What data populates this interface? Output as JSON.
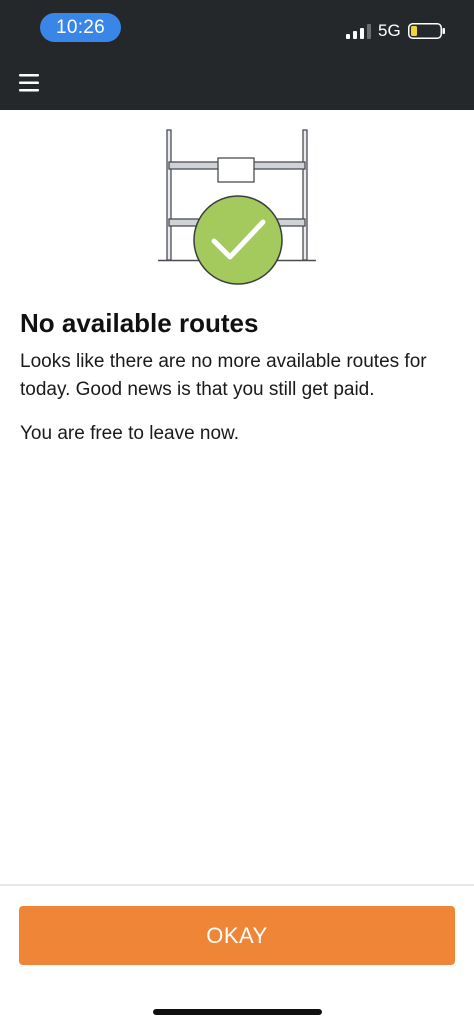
{
  "status_bar": {
    "time": "10:26",
    "network": "5G",
    "signal_icon": "cellular-signal-icon",
    "battery_icon": "battery-low-icon",
    "battery_level": 0.2
  },
  "app_bar": {
    "menu_icon": "hamburger-menu-icon"
  },
  "illustration": {
    "icon": "empty-rack-checkmark-illustration"
  },
  "content": {
    "title": "No available routes",
    "message": "Looks like there are no more available routes for today. Good news is that you still get paid.",
    "secondary_message": "You are free to leave now."
  },
  "footer": {
    "okay_label": "OKAY"
  },
  "colors": {
    "header_bg": "#25282b",
    "time_pill": "#3a86e8",
    "accent": "#ef8536",
    "check_green": "#a4c95c"
  }
}
